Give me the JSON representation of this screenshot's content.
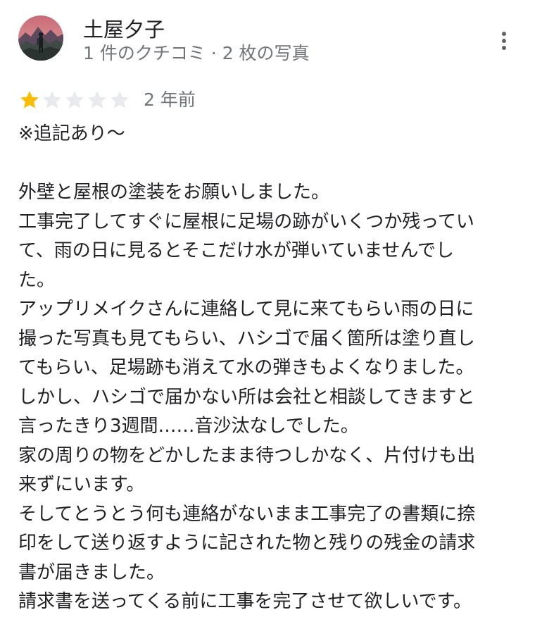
{
  "author": {
    "name": "土屋夕子",
    "meta": "1 件のクチコミ · 2 枚の写真",
    "avatar_icon": "mountain-hiker-avatar"
  },
  "menu": {
    "icon": "more-vert-icon"
  },
  "rating": {
    "value": 1,
    "max": 5,
    "filled_color": "#fbbc04",
    "empty_color": "#e8eaed"
  },
  "date": "2 年前",
  "review_lines": [
    "※追記あり～",
    "",
    "外壁と屋根の塗装をお願いしました。",
    "工事完了してすぐに屋根に足場の跡がいくつか残ってい",
    "て、雨の日に見るとそこだけ水が弾いていませんでし",
    "た。",
    "アップリメイクさんに連絡して見に来てもらい雨の日に",
    "撮った写真も見てもらい、ハシゴで届く箇所は塗り直し",
    "てもらい、足場跡も消えて水の弾きもよくなりました。",
    "しかし、ハシゴで届かない所は会社と相談してきますと",
    "言ったきり3週間……音沙汰なしでした。",
    "家の周りの物をどかしたまま待つしかなく、片付けも出",
    "来ずにいます。",
    "そしてとうとう何も連絡がないまま工事完了の書類に捺",
    "印をして送り返すように記された物と残りの残金の請求",
    "書が届きました。",
    "請求書を送ってくる前に工事を完了させて欲しいです。"
  ]
}
